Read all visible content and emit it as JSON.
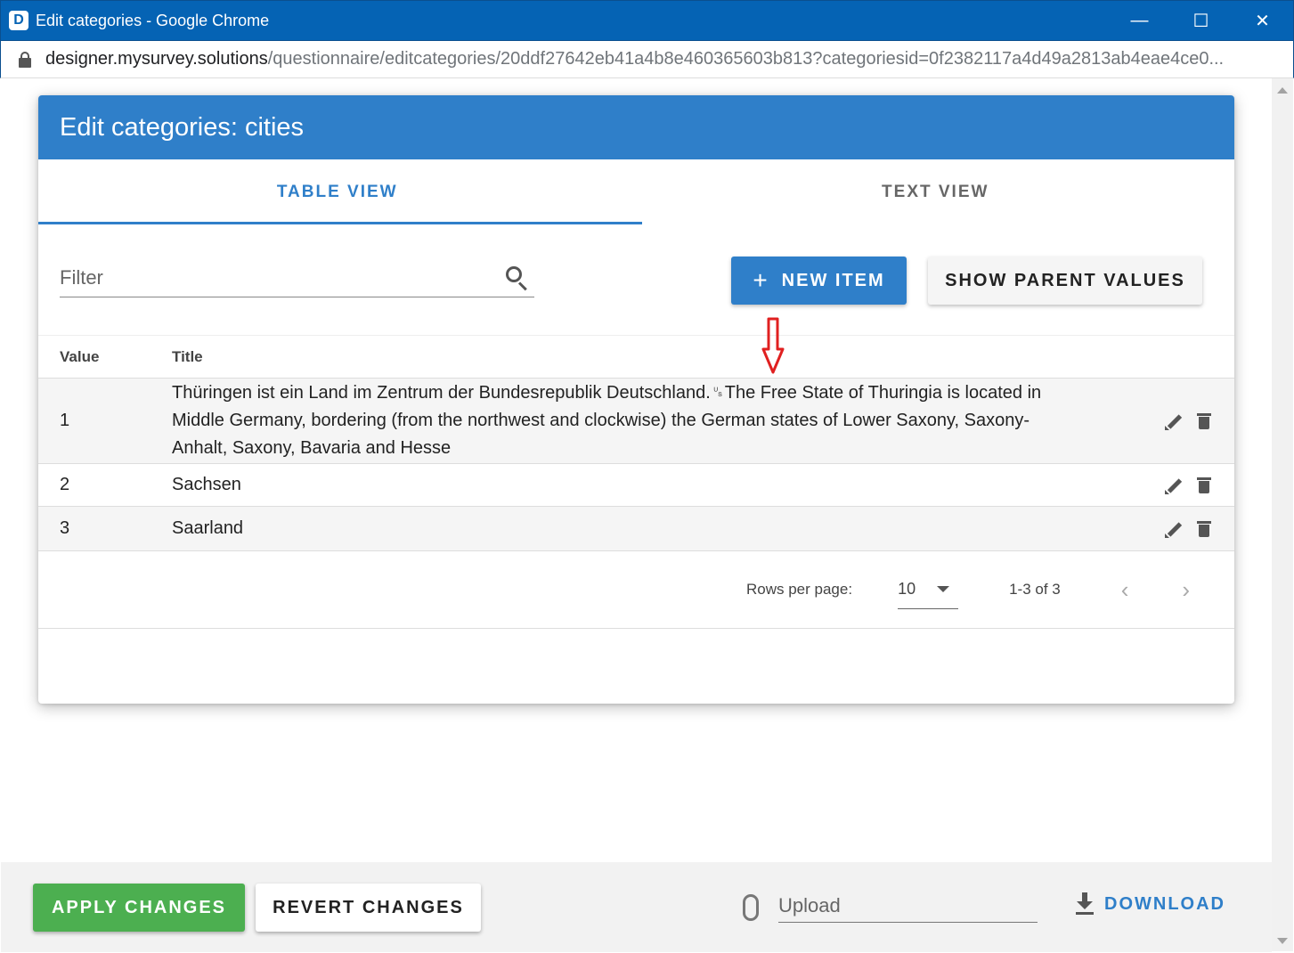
{
  "window": {
    "app_letter": "D",
    "title": "Edit categories - Google Chrome",
    "url_host": "designer.mysurvey.solutions",
    "url_path": "/questionnaire/editcategories/20ddf27642eb41a4b8e460365603b813?categoriesid=0f2382117a4d49a2813ab4eae4ce0..."
  },
  "dialog": {
    "title": "Edit categories: cities",
    "tabs": [
      {
        "label": "TABLE VIEW",
        "active": true
      },
      {
        "label": "TEXT VIEW",
        "active": false
      }
    ],
    "filter_placeholder": "Filter",
    "new_item_label": "NEW ITEM",
    "show_parent_label": "SHOW PARENT VALUES",
    "columns": {
      "value": "Value",
      "title": "Title"
    },
    "rows": [
      {
        "value": "1",
        "title": "Thüringen ist ein Land im Zentrum der Bundesrepublik Deutschland.␟The Free State of Thuringia is located in Middle Germany, bordering (from the northwest and clockwise) the German states of Lower Saxony, Saxony-Anhalt, Saxony, Bavaria and Hesse"
      },
      {
        "value": "2",
        "title": "Sachsen"
      },
      {
        "value": "3",
        "title": "Saarland"
      }
    ],
    "pagination": {
      "rows_per_page_label": "Rows per page:",
      "rows_per_page": "10",
      "range": "1-3 of 3"
    }
  },
  "footer": {
    "apply_label": "APPLY CHANGES",
    "revert_label": "REVERT CHANGES",
    "upload_placeholder": "Upload",
    "download_label": "DOWNLOAD"
  },
  "colors": {
    "titlebar": "#0563b4",
    "primary": "#2f7fc9",
    "apply": "#4caf50",
    "annotation": "#e02020"
  },
  "icons": [
    "lock-icon",
    "search-icon",
    "plus-icon",
    "pencil-icon",
    "trash-icon",
    "caret-down-icon",
    "chevron-left-icon",
    "chevron-right-icon",
    "paperclip-icon",
    "download-icon",
    "minimize-icon",
    "maximize-icon",
    "close-icon"
  ]
}
